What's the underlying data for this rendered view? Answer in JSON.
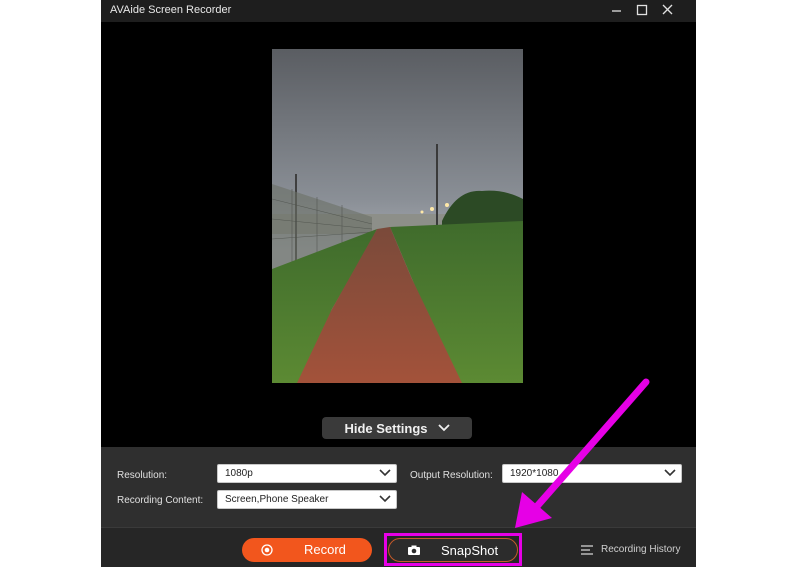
{
  "window": {
    "title": "AVAide Screen Recorder"
  },
  "preview": {
    "alt": "Night photo of a dirt path between grass and a fence"
  },
  "settings": {
    "toggle_label": "Hide Settings",
    "resolution_label": "Resolution:",
    "resolution_value": "1080p",
    "output_resolution_label": "Output Resolution:",
    "output_resolution_value": "1920*1080",
    "recording_content_label": "Recording Content:",
    "recording_content_value": "Screen,Phone Speaker"
  },
  "controls": {
    "record_label": "Record",
    "snapshot_label": "SnapShot",
    "history_label": "Recording History"
  },
  "colors": {
    "record_orange": "#f2561d",
    "highlight_magenta": "#e600e6",
    "window_bg": "#000000"
  }
}
